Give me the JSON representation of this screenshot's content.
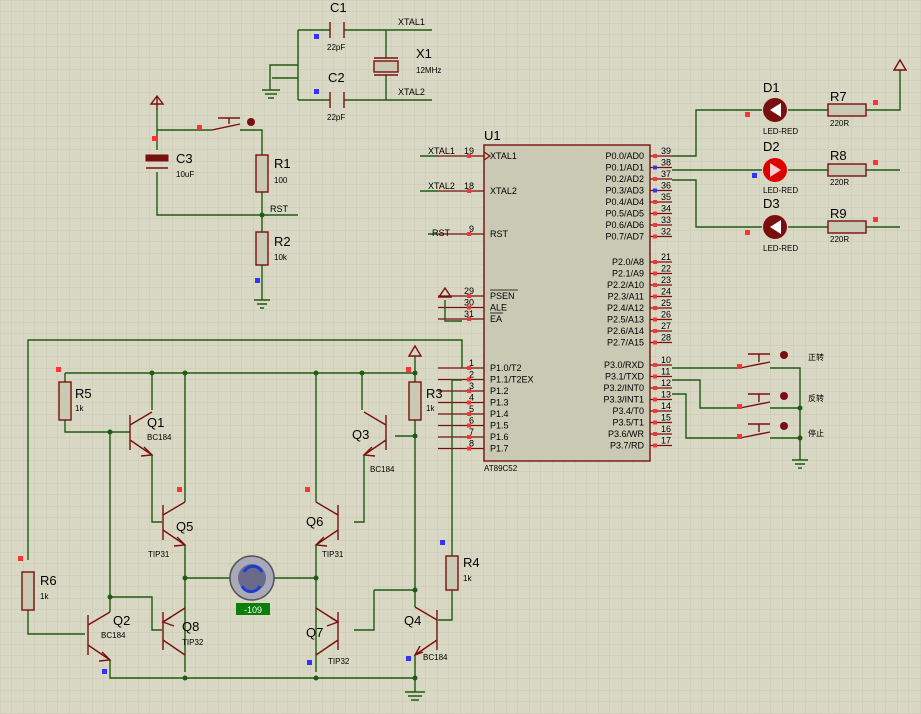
{
  "colors": {
    "background": "#d9d8c4",
    "grid": "#c8c7b0",
    "wire": "#1f5b10",
    "component": "#7a0f0f",
    "ic_fill": "#c9c9b4",
    "led": "#cc0000",
    "pin_red": "#ff3333",
    "pin_blue": "#3333ff",
    "meter": "#0a7f0a"
  },
  "components": {
    "C1": {
      "ref": "C1",
      "value": "22pF"
    },
    "C2": {
      "ref": "C2",
      "value": "22pF"
    },
    "X1": {
      "ref": "X1",
      "value": "12MHz"
    },
    "C3": {
      "ref": "C3",
      "value": "10uF"
    },
    "R1": {
      "ref": "R1",
      "value": "100"
    },
    "R2": {
      "ref": "R2",
      "value": "10k"
    },
    "R3": {
      "ref": "R3",
      "value": "1k"
    },
    "R4": {
      "ref": "R4",
      "value": "1k"
    },
    "R5": {
      "ref": "R5",
      "value": "1k"
    },
    "R6": {
      "ref": "R6",
      "value": "1k"
    },
    "R7": {
      "ref": "R7",
      "value": "220R"
    },
    "R8": {
      "ref": "R8",
      "value": "220R"
    },
    "R9": {
      "ref": "R9",
      "value": "220R"
    },
    "D1": {
      "ref": "D1",
      "value": "LED-RED"
    },
    "D2": {
      "ref": "D2",
      "value": "LED-RED"
    },
    "D3": {
      "ref": "D3",
      "value": "LED-RED"
    },
    "Q1": {
      "ref": "Q1",
      "value": "BC184"
    },
    "Q2": {
      "ref": "Q2",
      "value": "BC184"
    },
    "Q3": {
      "ref": "Q3",
      "value": "BC184"
    },
    "Q4": {
      "ref": "Q4",
      "value": "BC184"
    },
    "Q5": {
      "ref": "Q5",
      "value": "TIP31"
    },
    "Q6": {
      "ref": "Q6",
      "value": "TIP31"
    },
    "Q7": {
      "ref": "Q7",
      "value": "TIP32"
    },
    "Q8": {
      "ref": "Q8",
      "value": "TIP32"
    },
    "U1": {
      "ref": "U1",
      "value": "AT89C52"
    },
    "motor": {
      "reading": "-109"
    }
  },
  "net_labels": {
    "xtal1_top": "XTAL1",
    "xtal2_top": "XTAL2",
    "rst_r": "RST",
    "xtal1_u": "XTAL1",
    "xtal2_u": "XTAL2",
    "rst_u": "RST"
  },
  "switches": {
    "forward": "正转",
    "reverse": "反转",
    "stop": "停止"
  },
  "ic": {
    "left_top": [
      {
        "num": "19",
        "name": "XTAL1"
      },
      {
        "num": "18",
        "name": "XTAL2"
      },
      {
        "num": "9",
        "name": "RST"
      }
    ],
    "left_mid": [
      {
        "num": "29",
        "name": "PSEN"
      },
      {
        "num": "30",
        "name": "ALE"
      },
      {
        "num": "31",
        "name": "EA"
      }
    ],
    "left_p1": [
      {
        "num": "1",
        "name": "P1.0/T2"
      },
      {
        "num": "2",
        "name": "P1.1/T2EX"
      },
      {
        "num": "3",
        "name": "P1.2"
      },
      {
        "num": "4",
        "name": "P1.3"
      },
      {
        "num": "5",
        "name": "P1.4"
      },
      {
        "num": "6",
        "name": "P1.5"
      },
      {
        "num": "7",
        "name": "P1.6"
      },
      {
        "num": "8",
        "name": "P1.7"
      }
    ],
    "right_p0": [
      {
        "num": "39",
        "name": "P0.0/AD0"
      },
      {
        "num": "38",
        "name": "P0.1/AD1"
      },
      {
        "num": "37",
        "name": "P0.2/AD2"
      },
      {
        "num": "36",
        "name": "P0.3/AD3"
      },
      {
        "num": "35",
        "name": "P0.4/AD4"
      },
      {
        "num": "34",
        "name": "P0.5/AD5"
      },
      {
        "num": "33",
        "name": "P0.6/AD6"
      },
      {
        "num": "32",
        "name": "P0.7/AD7"
      }
    ],
    "right_p2": [
      {
        "num": "21",
        "name": "P2.0/A8"
      },
      {
        "num": "22",
        "name": "P2.1/A9"
      },
      {
        "num": "23",
        "name": "P2.2/A10"
      },
      {
        "num": "24",
        "name": "P2.3/A11"
      },
      {
        "num": "25",
        "name": "P2.4/A12"
      },
      {
        "num": "26",
        "name": "P2.5/A13"
      },
      {
        "num": "27",
        "name": "P2.6/A14"
      },
      {
        "num": "28",
        "name": "P2.7/A15"
      }
    ],
    "right_p3": [
      {
        "num": "10",
        "name": "P3.0/RXD"
      },
      {
        "num": "11",
        "name": "P3.1/TXD"
      },
      {
        "num": "12",
        "name": "P3.2/INT0"
      },
      {
        "num": "13",
        "name": "P3.3/INT1"
      },
      {
        "num": "14",
        "name": "P3.4/T0"
      },
      {
        "num": "15",
        "name": "P3.5/T1"
      },
      {
        "num": "16",
        "name": "P3.6/WR"
      },
      {
        "num": "17",
        "name": "P3.7/RD"
      }
    ]
  }
}
